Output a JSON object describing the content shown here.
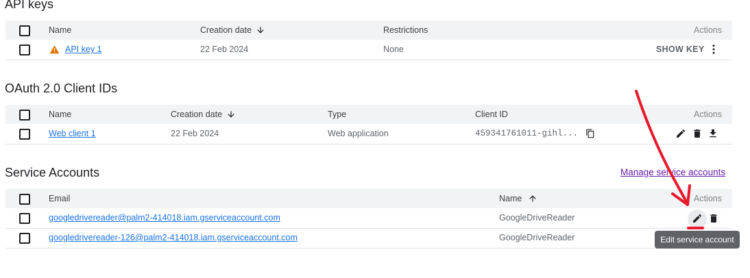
{
  "api_keys": {
    "title": "API keys",
    "columns": {
      "name": "Name",
      "creation_date": "Creation date",
      "restrictions": "Restrictions",
      "actions": "Actions"
    },
    "rows": [
      {
        "name": "API key 1",
        "creation_date": "22 Feb 2024",
        "restrictions": "None",
        "show_key": "SHOW KEY"
      }
    ]
  },
  "oauth": {
    "title": "OAuth 2.0 Client IDs",
    "columns": {
      "name": "Name",
      "creation_date": "Creation date",
      "type": "Type",
      "client_id": "Client ID",
      "actions": "Actions"
    },
    "rows": [
      {
        "name": "Web client 1",
        "creation_date": "22 Feb 2024",
        "type": "Web application",
        "client_id": "459341761011-gihl..."
      }
    ]
  },
  "service_accounts": {
    "title": "Service Accounts",
    "manage_link": "Manage service accounts",
    "columns": {
      "email": "Email",
      "name": "Name",
      "actions": "Actions"
    },
    "rows": [
      {
        "email": "googledrivereader@palm2-414018.iam.gserviceaccount.com",
        "name": "GoogleDriveReader"
      },
      {
        "email": "googledrivereader-126@palm2-414018.iam.gserviceaccount.com",
        "name": "GoogleDriveReader"
      }
    ]
  },
  "tooltip": "Edit service account",
  "colors": {
    "link": "#1a73e8",
    "warning": "#e37400",
    "annotation": "#e8192c",
    "visited_link": "#681da8"
  },
  "icons": [
    "warning-icon",
    "more-vert-icon",
    "arrow-down-icon",
    "arrow-up-icon",
    "edit-icon",
    "delete-icon",
    "download-icon",
    "copy-icon"
  ]
}
